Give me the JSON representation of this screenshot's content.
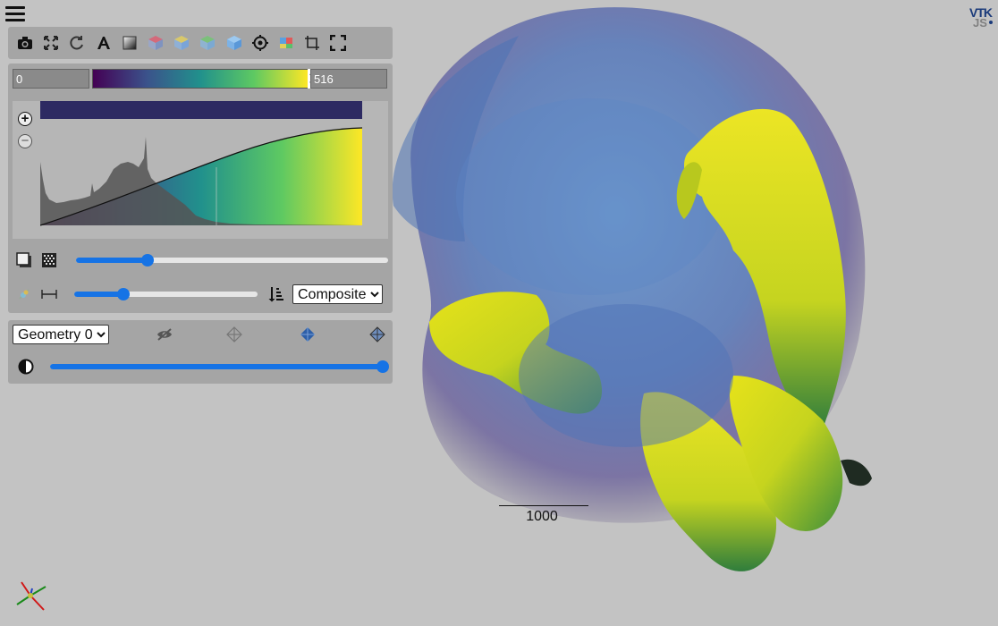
{
  "toolbar": {
    "icons": [
      "camera-icon",
      "reset-camera-icon",
      "rotate-icon",
      "text-icon",
      "gradient-icon",
      "cube-x-icon",
      "cube-y-icon",
      "cube-z-icon",
      "cube-iso-icon",
      "crosshair-icon",
      "colors-icon",
      "crop-icon",
      "fullscreen-icon"
    ]
  },
  "transfer_function": {
    "range_min": "0",
    "range_max": "516",
    "colormap_colors": [
      "#440154",
      "#3b528b",
      "#21918c",
      "#5ec962",
      "#fde725"
    ],
    "opacity_bar_color": "#2d2a62",
    "sample_distance_fraction": 0.23,
    "edge_gradient_fraction": 0.27,
    "blend_mode": "Composite",
    "blend_options": [
      "Composite"
    ]
  },
  "geometry": {
    "selected": "Geometry 0",
    "options": [
      "Geometry 0"
    ],
    "opacity_fraction": 1.0
  },
  "viewport": {
    "background_color": "#c3c3c3",
    "scale_bar_label": "1000"
  },
  "brand": {
    "logo_text_a": "VTK",
    "logo_text_b": "JS"
  }
}
